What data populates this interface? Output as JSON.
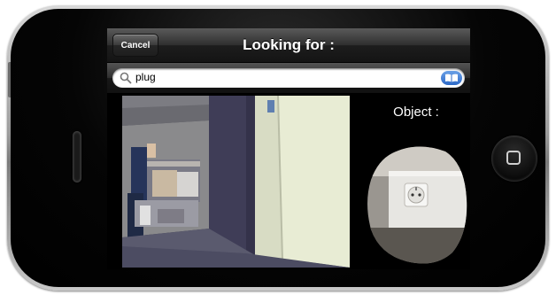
{
  "navbar": {
    "cancel_label": "Cancel",
    "title": "Looking for :"
  },
  "search": {
    "query": "plug",
    "icon": "search-icon",
    "accessory_icon": "bookmarks-icon"
  },
  "object_panel": {
    "label": "Object :"
  },
  "device": {
    "home_button_icon": "home-square-icon"
  },
  "colors": {
    "accent_blue": "#2c69c7",
    "navbar_dark": "#1d1d1d"
  }
}
